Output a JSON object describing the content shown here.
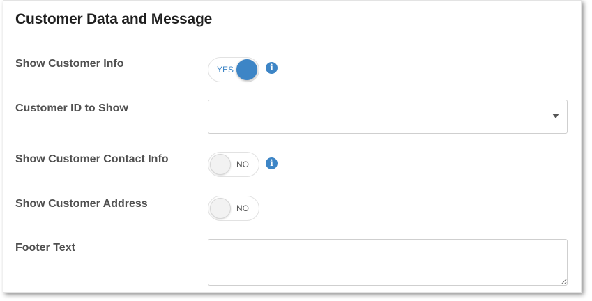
{
  "section": {
    "title": "Customer Data and Message"
  },
  "fields": {
    "show_customer_info": {
      "label": "Show Customer Info",
      "toggle_text": "YES",
      "info_icon": "info-icon"
    },
    "customer_id": {
      "label": "Customer ID to Show",
      "selected_value": "",
      "caret_icon": "caret-down-icon"
    },
    "show_contact_info": {
      "label": "Show Customer Contact Info",
      "toggle_text": "NO",
      "info_icon": "info-icon"
    },
    "show_address": {
      "label": "Show Customer Address",
      "toggle_text": "NO"
    },
    "footer_text": {
      "label": "Footer Text",
      "value": ""
    }
  },
  "colors": {
    "accent": "#3d85c6",
    "label": "#505050",
    "title": "#1f1f1f"
  }
}
